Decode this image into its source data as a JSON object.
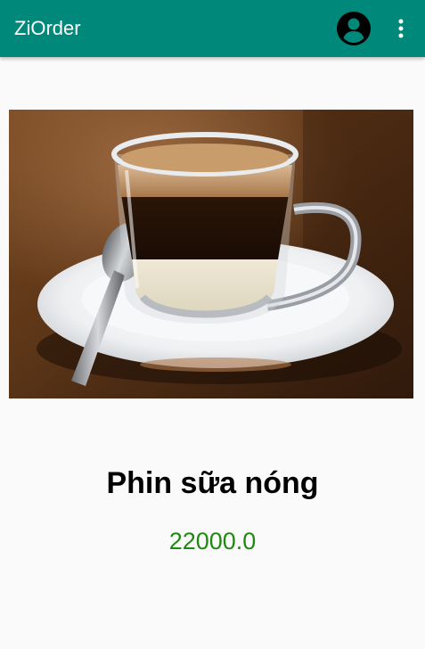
{
  "app_bar": {
    "title": "ZiOrder",
    "background_color": "#00897b",
    "actions": [
      {
        "icon": "account-circle-icon"
      },
      {
        "icon": "more-vert-icon"
      }
    ]
  },
  "product": {
    "image_subject": "coffee-cup-icon",
    "name": "Phin sữa nóng",
    "price": "22000.0",
    "price_color": "#1f8a12"
  }
}
